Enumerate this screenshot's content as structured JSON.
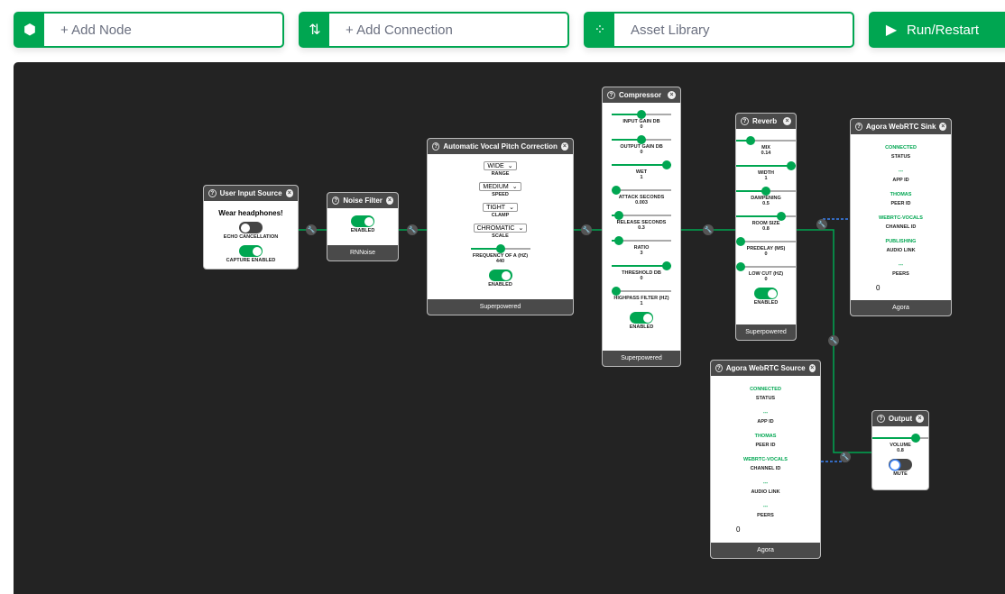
{
  "toolbar": {
    "add_node": "+ Add Node",
    "add_connection": "+ Add Connection",
    "asset_library": "Asset Library",
    "run": "Run/Restart"
  },
  "colors": {
    "accent": "#00a651",
    "canvas": "#232323",
    "node_header": "#4a4a4a",
    "link_dashed": "#3b82f6"
  },
  "nodes": [
    {
      "id": "user-input-source",
      "title": "User Input Source",
      "controls": [
        {
          "type": "text",
          "text": "Wear headphones!"
        },
        {
          "type": "toggle",
          "label": "ECHO CANCELLATION",
          "on": false
        },
        {
          "type": "toggle",
          "label": "CAPTURE ENABLED",
          "on": true
        }
      ]
    },
    {
      "id": "noise-filter",
      "title": "Noise Filter",
      "footer": "RNNoise",
      "controls": [
        {
          "type": "toggle",
          "label": "ENABLED",
          "on": true
        }
      ]
    },
    {
      "id": "pitch-correction",
      "title": "Automatic Vocal Pitch Correction",
      "footer": "Superpowered",
      "controls": [
        {
          "type": "select",
          "value": "WIDE",
          "label": "RANGE"
        },
        {
          "type": "select",
          "value": "MEDIUM",
          "label": "SPEED"
        },
        {
          "type": "select",
          "value": "TIGHT",
          "label": "CLAMP"
        },
        {
          "type": "select",
          "value": "CHROMATIC",
          "label": "SCALE"
        },
        {
          "type": "slider",
          "label": "FREQUENCY OF A (HZ)",
          "value": "440",
          "level": 0.5
        },
        {
          "type": "toggle",
          "label": "ENABLED",
          "on": true
        }
      ]
    },
    {
      "id": "compressor",
      "title": "Compressor",
      "footer": "Superpowered",
      "controls": [
        {
          "type": "slider",
          "label": "INPUT GAIN DB",
          "value": "0",
          "level": 0.5
        },
        {
          "type": "slider",
          "label": "OUTPUT GAIN DB",
          "value": "0",
          "level": 0.5
        },
        {
          "type": "slider",
          "label": "WET",
          "value": "1",
          "level": 1
        },
        {
          "type": "slider",
          "label": "ATTACK SECONDS",
          "value": "0.003",
          "level": 0
        },
        {
          "type": "slider",
          "label": "RELEASE SECONDS",
          "value": "0.3",
          "level": 0.05
        },
        {
          "type": "slider",
          "label": "RATIO",
          "value": "3",
          "level": 0.06
        },
        {
          "type": "slider",
          "label": "THRESHOLD DB",
          "value": "0",
          "level": 1
        },
        {
          "type": "slider",
          "label": "HIGHPASS FILTER (HZ)",
          "value": "1",
          "level": 0
        },
        {
          "type": "toggle",
          "label": "ENABLED",
          "on": true
        }
      ]
    },
    {
      "id": "reverb",
      "title": "Reverb",
      "footer": "Superpowered",
      "controls": [
        {
          "type": "slider",
          "label": "MIX",
          "value": "0.14",
          "level": 0.2
        },
        {
          "type": "slider",
          "label": "WIDTH",
          "value": "1",
          "level": 1
        },
        {
          "type": "slider",
          "label": "DAMPENING",
          "value": "0.5",
          "level": 0.5
        },
        {
          "type": "slider",
          "label": "ROOM SIZE",
          "value": "0.8",
          "level": 0.8
        },
        {
          "type": "slider",
          "label": "PREDELAY (MS)",
          "value": "0",
          "level": 0
        },
        {
          "type": "slider",
          "label": "LOW CUT (HZ)",
          "value": "0",
          "level": 0
        },
        {
          "type": "toggle",
          "label": "ENABLED",
          "on": true
        }
      ]
    },
    {
      "id": "agora-sink",
      "title": "Agora WebRTC Sink",
      "footer": "Agora",
      "controls": [
        {
          "type": "status",
          "value": "CONNECTED",
          "label": "STATUS"
        },
        {
          "type": "status",
          "value": "---",
          "label": "APP ID"
        },
        {
          "type": "status",
          "value": "THOMAS",
          "label": "PEER ID"
        },
        {
          "type": "status",
          "value": "WEBRTC-VOCALS",
          "label": "CHANNEL ID"
        },
        {
          "type": "status",
          "value": "PUBLISHING",
          "label": "AUDIO LINK"
        },
        {
          "type": "status",
          "value": "---",
          "label": "PEERS"
        },
        {
          "type": "plain",
          "text": "0"
        }
      ]
    },
    {
      "id": "agora-source",
      "title": "Agora WebRTC Source",
      "footer": "Agora",
      "controls": [
        {
          "type": "status",
          "value": "CONNECTED",
          "label": "STATUS"
        },
        {
          "type": "status",
          "value": "---",
          "label": "APP ID"
        },
        {
          "type": "status",
          "value": "THOMAS",
          "label": "PEER ID"
        },
        {
          "type": "status",
          "value": "WEBRTC-VOCALS",
          "label": "CHANNEL ID"
        },
        {
          "type": "status",
          "value": "---",
          "label": "AUDIO LINK"
        },
        {
          "type": "status",
          "value": "---",
          "label": "PEERS"
        },
        {
          "type": "plain",
          "text": "0"
        }
      ]
    },
    {
      "id": "output",
      "title": "Output",
      "controls": [
        {
          "type": "slider",
          "label": "VOLUME",
          "value": "0.8",
          "level": 0.8
        },
        {
          "type": "toggle",
          "label": "MUTE",
          "on": false,
          "focus": true
        }
      ]
    }
  ]
}
